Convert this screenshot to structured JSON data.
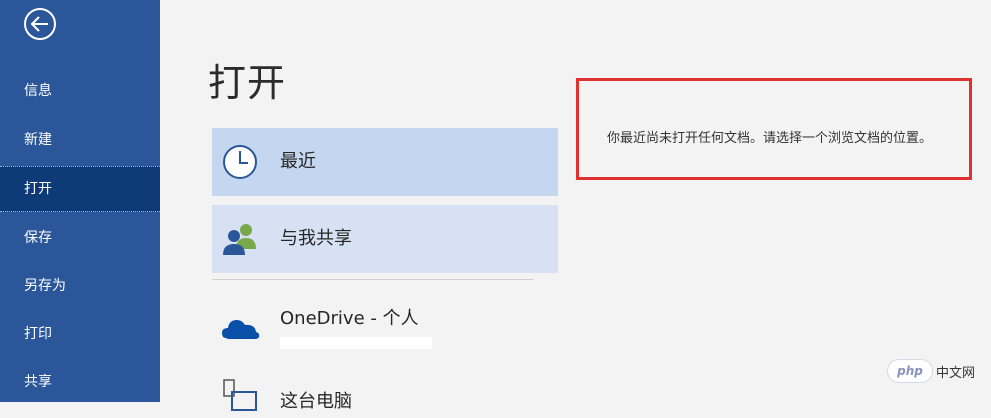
{
  "sidebar": {
    "back_icon": "back-arrow-icon",
    "items": [
      {
        "label": "信息"
      },
      {
        "label": "新建"
      },
      {
        "label": "打开"
      },
      {
        "label": "保存"
      },
      {
        "label": "另存为"
      },
      {
        "label": "打印"
      },
      {
        "label": "共享"
      }
    ],
    "active_index": 2,
    "bg_color": "#2b579a",
    "active_color": "#0e3a77"
  },
  "main": {
    "title": "打开",
    "locations": [
      {
        "label": "最近",
        "icon": "clock-icon"
      },
      {
        "label": "与我共享",
        "icon": "people-icon"
      },
      {
        "label": "OneDrive - 个人",
        "icon": "onedrive-cloud-icon"
      },
      {
        "label": "这台电脑",
        "icon": "computer-icon"
      }
    ],
    "message": "你最近尚未打开任何文档。请选择一个浏览文档的位置。"
  },
  "watermark": {
    "badge": "php",
    "text": "中文网"
  }
}
